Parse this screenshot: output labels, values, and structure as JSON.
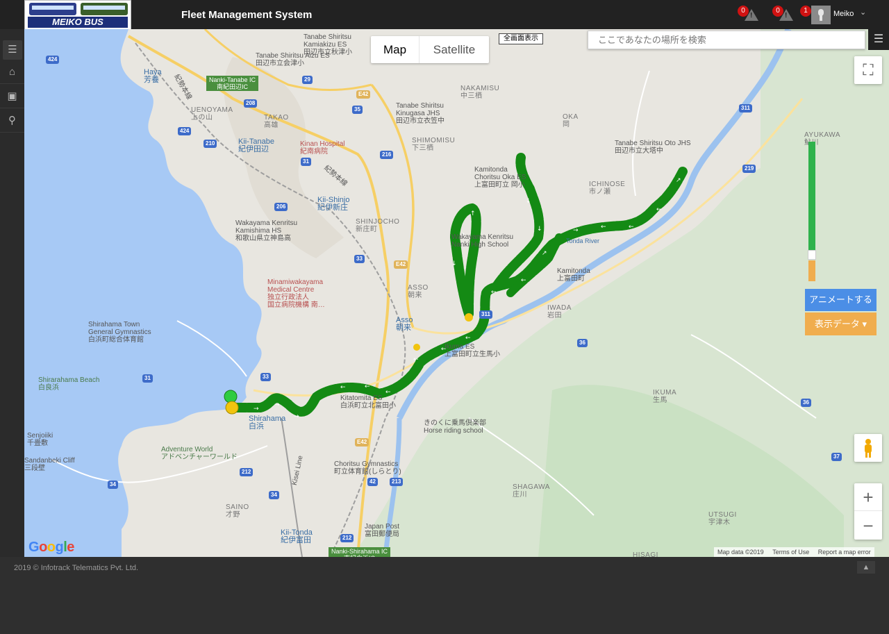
{
  "header": {
    "logo_text": "MEIKO BUS",
    "app_title": "Fleet Management System",
    "alerts": [
      {
        "count": "0"
      },
      {
        "count": "0"
      },
      {
        "count": "1"
      }
    ],
    "user_name": "Meiko"
  },
  "sidebar": {
    "items": [
      {
        "icon": "menu-icon"
      },
      {
        "icon": "home-icon"
      },
      {
        "icon": "bus-icon"
      },
      {
        "icon": "location-pin-icon"
      }
    ]
  },
  "map": {
    "type_tabs": [
      "Map",
      "Satellite"
    ],
    "fullscreen_text_button": "全画面表示",
    "search_placeholder": "ここであなたの場所を検索",
    "animate_button": "アニメートする",
    "display_data_button": "表示データ ▾",
    "attribution": [
      "Map data ©2019",
      "Terms of Use",
      "Report a map error"
    ],
    "labels": {
      "kamiakizu": "Tanabe Shiritsu\nKamiakizu ES\n田辺市立秋津小",
      "aizu": "Tanabe Shiritsu Aizu ES\n田辺市立会津小",
      "haya": "Haya\n芳養",
      "nanki_tanabe_ic": "Nanki-Tanabe IC\n南紀田辺IC",
      "uenoyama": "UENOYAMA\n上の山",
      "takao": "TAKAO\n高雄",
      "kii_tanabe": "Kii-Tanabe\n紀伊田辺",
      "kinan_hospital": "Kinan Hospital\n紀南病院",
      "nakamisu": "NAKAMISU\n中三栖",
      "kinugasa": "Tanabe Shiritsu\nKinugasa JHS\n田辺市立衣笠中",
      "shimomisu": "SHIMOMISU\n下三栖",
      "oka": "OKA\n岡",
      "kamitonda_es": "Kamitonda\nChoritsu Oka ES\n上富田町立 岡小",
      "oto_jhs": "Tanabe Shiritsu Oto JHS\n田辺市立大塔中",
      "ayukawa": "AYUKAWA\n鮎川",
      "ichinose": "ICHINOSE\n市ノ瀬",
      "kii_shinjo": "Kii-Shinjo\n紀伊新庄",
      "shinjocho": "SHINJOCHO\n新庄町",
      "kamishima": "Wakayama Kenritsu\nKamishima HS\n和歌山県立神島高",
      "nanki_hs": "Wakayama Kenritsu\nNanki High School",
      "tonda_river": "Tonda River",
      "kamitonda": "Kamitonda\n上富田町",
      "minami_medical": "Minamiwakayama\nMedical Centre\n独立行政法人\n国立病院機構 南…",
      "asso": "ASSO\n朝来",
      "asso_station": "Asso\n朝来",
      "iwada": "IWADA\n岩田",
      "ikuma_es": "Ikuma ES\n上富田町立生馬小",
      "shirahama_gym": "Shirahama Town\nGeneral Gymnastics\n白浜町総合体育館",
      "shirarahama_beach": "Shirarahama Beach\n白良浜",
      "kitatomita": "Kitatomita ES\n白浜町立北富田小",
      "shirahama": "Shirahama\n白浜",
      "ikuma": "IKUMA\n生馬",
      "horse_club": "きのくに乗馬倶楽部\nHorse riding school",
      "senjojiki": "Senjoiiki\n千畳敷",
      "sandanbeki": "Sandanbeki Cliff\n三段壁",
      "adventure_world": "Adventure World\nアドベンチャーワールド",
      "kisei_line": "Kisei Line",
      "choritsu_gym": "Choritsu Gymnastics\n町立体育館(しらとり)",
      "shagawa": "SHAGAWA\n庄川",
      "saino": "SAINO\n才野",
      "kii_tonda": "Kii-Tonda\n紀伊富田",
      "japan_post": "Japan Post\n富田郵便局",
      "nanki_shirahama_ic": "Nanki-Shirahama IC\n南紀白浜IC",
      "utsugi": "UTSUGI\n宇津木",
      "hisagi": "HISAGI",
      "kisei_honsen": "紀勢本線",
      "kisei_honsen2": "紀勢本線"
    }
  },
  "route": {
    "color_on_time": "#148a14",
    "color_late": "#c62828",
    "start_marker": "#2ecc40",
    "end_marker": "#f1c40f"
  },
  "footer": {
    "copyright": "2019 © Infotrack Telematics Pvt. Ltd.",
    "scroll_top": "▲"
  }
}
